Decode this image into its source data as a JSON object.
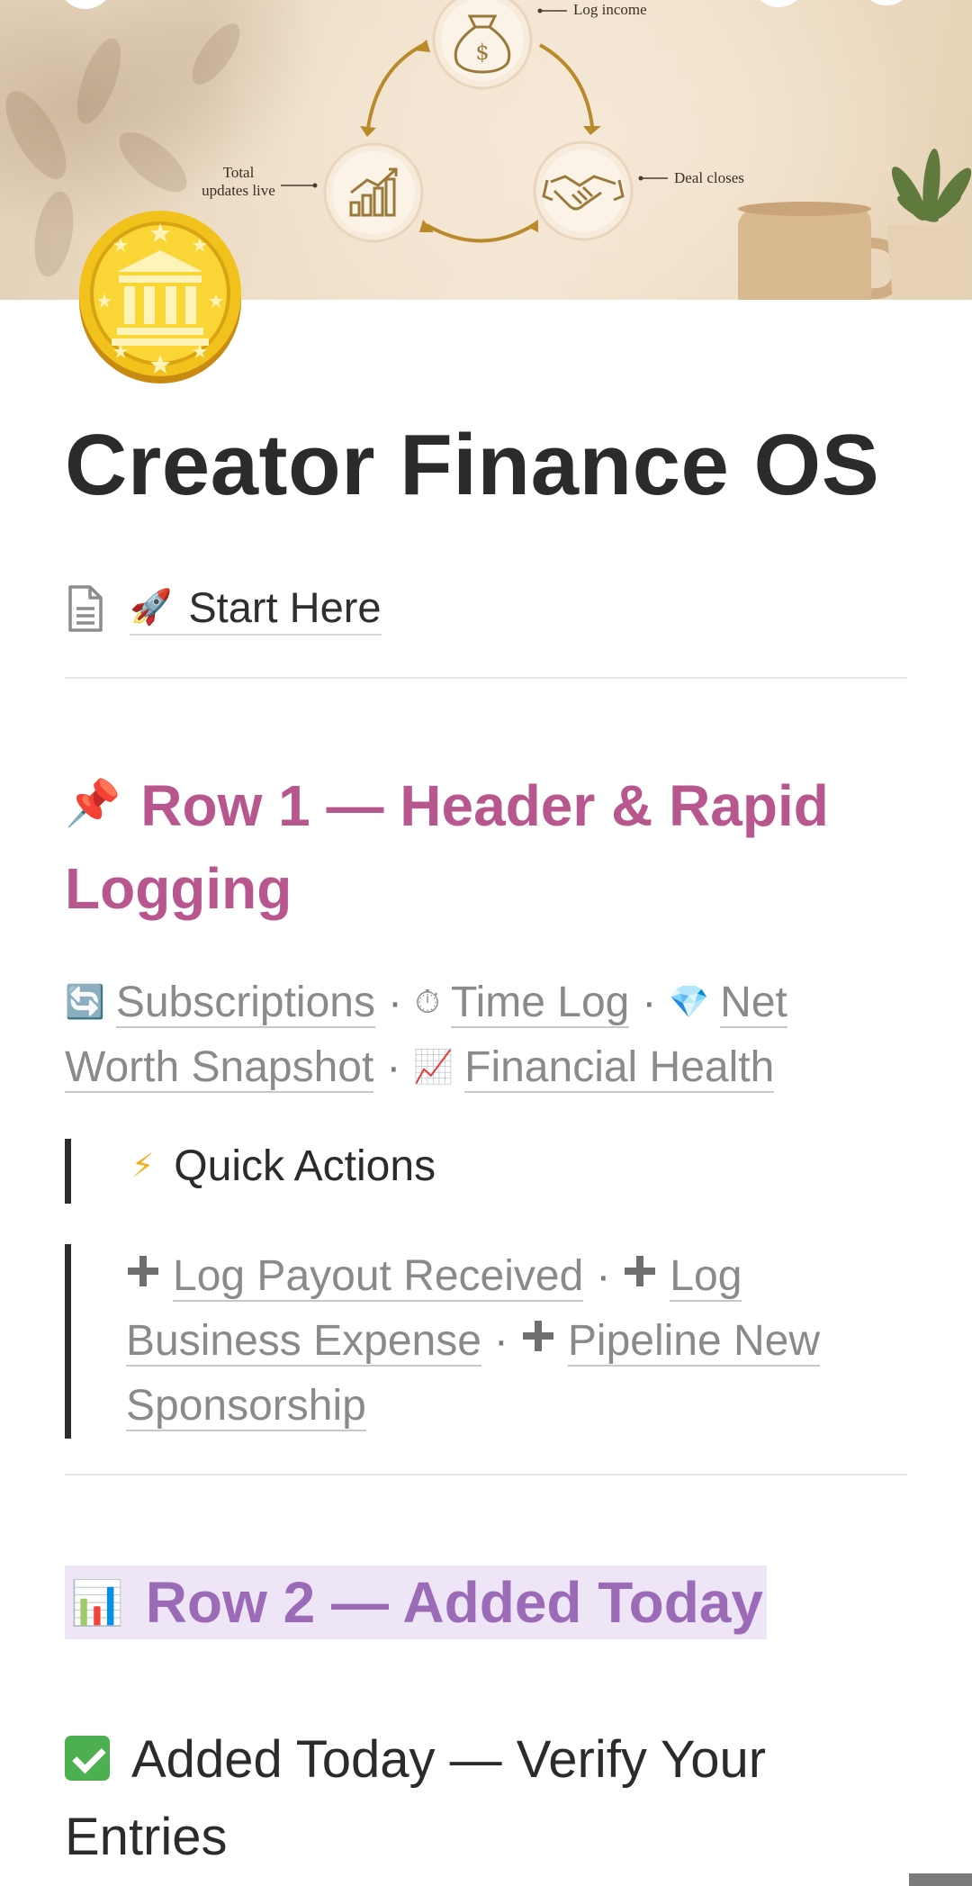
{
  "cover": {
    "label_log_income": "Log income",
    "label_deal_closes": "Deal closes",
    "label_total_line1": "Total",
    "label_total_line2": "updates live"
  },
  "page": {
    "title": "Creator Finance OS"
  },
  "start_here": {
    "emoji": "🚀",
    "label": "Start Here"
  },
  "row1": {
    "emoji": "📌",
    "heading": "Row 1 — Header & Rapid Logging",
    "links": [
      {
        "emoji": "🔄",
        "label": "Subscriptions"
      },
      {
        "emoji": "⏱",
        "label": "Time Log"
      },
      {
        "emoji": "💎",
        "label": "Net Worth Snapshot"
      },
      {
        "emoji": "📈",
        "label": "Financial Health"
      }
    ],
    "separator": "·"
  },
  "quick_actions": {
    "emoji": "⚡",
    "title": "Quick Actions",
    "actions": [
      {
        "label": "Log Payout Received"
      },
      {
        "label": "Log Business Expense"
      },
      {
        "label": "Pipeline New Sponsorship"
      }
    ]
  },
  "row2": {
    "emoji": "📊",
    "heading": "Row 2 — Added Today"
  },
  "added_today": {
    "heading": "Added Today — Verify Your Entries"
  },
  "colors": {
    "row1_heading": "#b8568e",
    "row2_heading": "#9c6bb7",
    "row2_highlight": "#eee6f7",
    "link_gray": "#8a8a8a"
  }
}
